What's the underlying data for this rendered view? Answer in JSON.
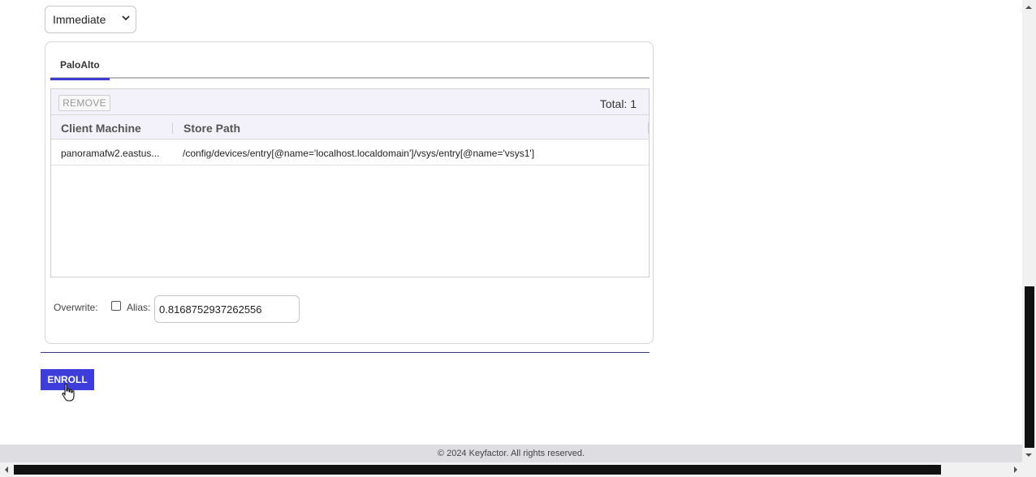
{
  "schedule": {
    "selected": "Immediate"
  },
  "tabs": [
    {
      "label": "PaloAlto"
    }
  ],
  "grid": {
    "remove_label": "REMOVE",
    "total_label": "Total: 1",
    "columns": [
      "Client Machine",
      "Store Path"
    ],
    "rows": [
      {
        "client_machine": "panoramafw2.eastus...",
        "store_path": "/config/devices/entry[@name='localhost.localdomain']/vsys/entry[@name='vsys1']"
      }
    ]
  },
  "options": {
    "overwrite_label": "Overwrite:",
    "overwrite_checked": false,
    "alias_label": "Alias:",
    "alias_value": "0.8168752937262556"
  },
  "enroll_label": "ENROLL",
  "footer_text": "© 2024 Keyfactor. All rights reserved.",
  "colors": {
    "accent": "#3d3ddb",
    "tab_underline": "#3d3dcf",
    "divider": "#3a3a8c",
    "footer_bg": "#dedde2"
  },
  "icons": {
    "select": "chevron-down-icon",
    "cursor": "hand-pointer-icon"
  }
}
